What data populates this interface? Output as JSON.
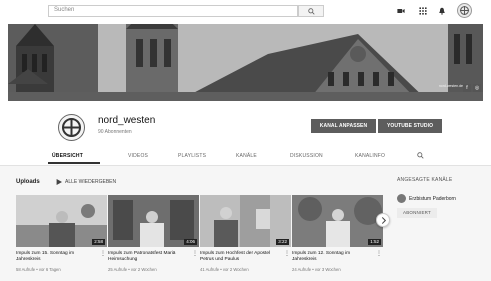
{
  "search": {
    "placeholder": "Suchen"
  },
  "banner": {
    "caption": "nord-westen.de",
    "social": [
      "f",
      "◎"
    ]
  },
  "channel": {
    "name": "nord_westen",
    "subscribers": "90 Abonnenten",
    "customize_label": "KANAL ANPASSEN",
    "studio_label": "YOUTUBE STUDIO"
  },
  "tabs": [
    "ÜBERSICHT",
    "VIDEOS",
    "PLAYLISTS",
    "KANÄLE",
    "DISKUSSION",
    "KANALINFO"
  ],
  "uploads": {
    "title": "Uploads",
    "play_all": "ALLE WIEDERGEBEN"
  },
  "videos": [
    {
      "title": "Impuls zum 15. Sonntag im Jahreskreis",
      "meta": "58 Aufrufe • vor 6 Tagen",
      "duration": "2:58"
    },
    {
      "title": "Impuls zum Patronatsfest Mariä Heimsuchung",
      "meta": "25 Aufrufe • vor 2 Wochen",
      "duration": "4:06"
    },
    {
      "title": "Impuls zum Hochfest der Apostel Petrus und Paulus",
      "meta": "41 Aufrufe • vor 2 Wochen",
      "duration": "3:22"
    },
    {
      "title": "Impuls zum 12. Sonntag im Jahreskreis",
      "meta": "24 Aufrufe • vor 3 Wochen",
      "duration": "1:52"
    }
  ],
  "sidebar": {
    "title": "ANGESAGTE KANÄLE",
    "channel": "Erzbistum Paderborn",
    "subscribed": "ABONNIERT"
  }
}
